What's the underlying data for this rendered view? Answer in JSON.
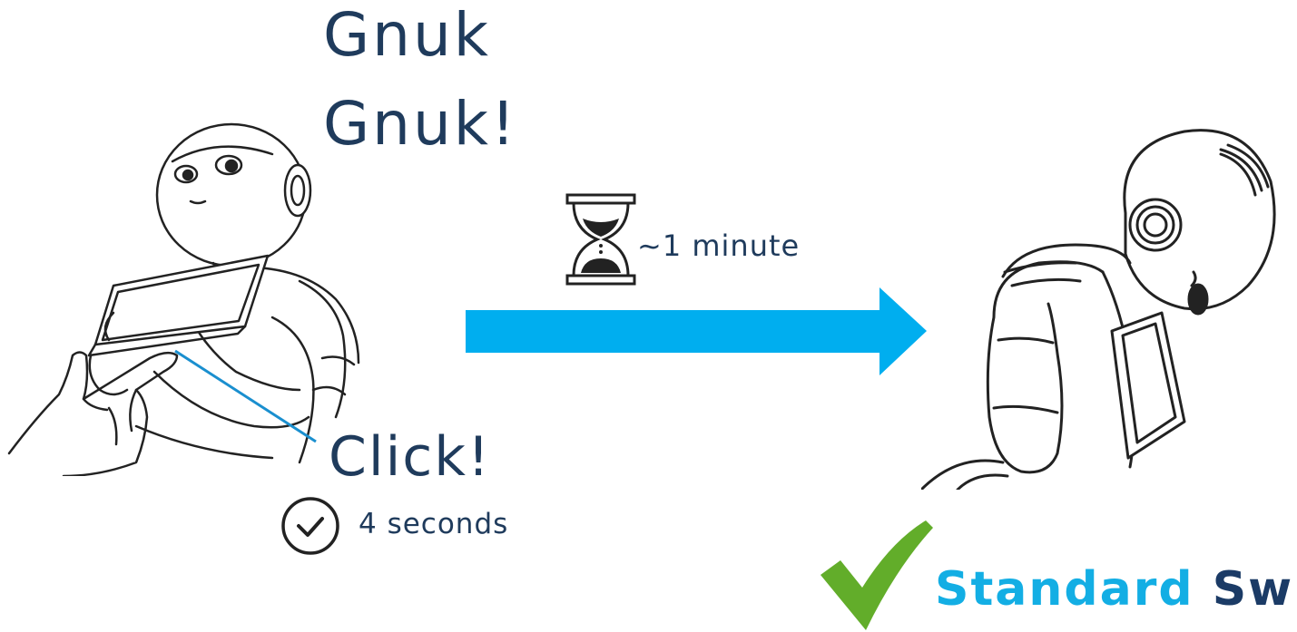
{
  "sound": {
    "line1": "Gnuk",
    "line2": "Gnuk!"
  },
  "action": {
    "label": "Click!"
  },
  "hold": {
    "duration": "4 seconds",
    "icon": "clock-check-icon"
  },
  "wait": {
    "duration": "~1 minute",
    "icon": "hourglass-icon"
  },
  "result": {
    "word1": "Standard",
    "word2": "Swit",
    "icon": "checkmark-icon"
  },
  "colors": {
    "text": "#1f3b5c",
    "arrow": "#00aeef",
    "check": "#62ad2a",
    "brand_light": "#13aee4",
    "brand_dark": "#1b3b66"
  }
}
